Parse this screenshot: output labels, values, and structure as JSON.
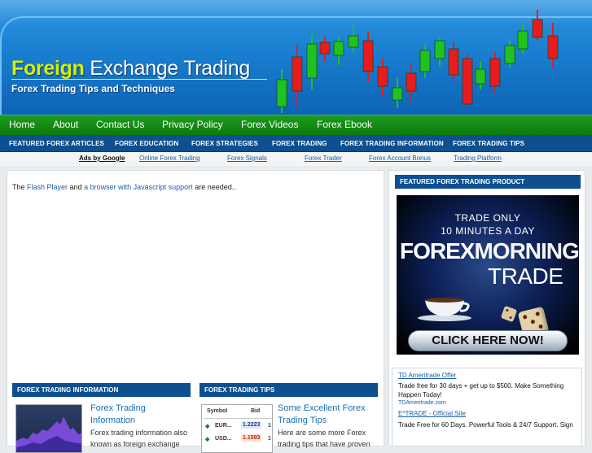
{
  "header": {
    "title_part1": "Foreign",
    "title_part2": "Exchange Trading",
    "tagline": "Forex Trading Tips and Techniques"
  },
  "nav": {
    "items": [
      "Home",
      "About",
      "Contact Us",
      "Privacy Policy",
      "Forex Videos",
      "Forex Ebook"
    ]
  },
  "categories": {
    "items": [
      "FEATURED FOREX ARTICLES",
      "FOREX EDUCATION",
      "FOREX STRATEGIES",
      "FOREX TRADING",
      "FOREX TRADING INFORMATION",
      "FOREX TRADING TIPS"
    ]
  },
  "ads_bar": {
    "label": "Ads by Google",
    "links": [
      "Online Forex Trading",
      "Forex Signals",
      "Forex Trader",
      "Forex Account Bonus",
      "Trading Platform"
    ]
  },
  "main": {
    "flash": {
      "pre": "The",
      "link1": "Flash Player",
      "mid": "and",
      "link2": "a browser with Javascript support",
      "post": "are needed.."
    },
    "sections": [
      {
        "heading": "FOREX TRADING INFORMATION",
        "title": "Forex Trading Information",
        "excerpt": "Forex trading information also known as foreign exchange"
      },
      {
        "heading": "FOREX TRADING TIPS",
        "title": "Some Excellent Forex Trading Tips",
        "excerpt": "Here are some more Forex trading tips that have proven"
      }
    ],
    "thumb_table": {
      "col_symbol": "Symbol",
      "col_bid": "Bid",
      "rows": [
        {
          "symbol": "EUR...",
          "bid": "1.2223",
          "extra": "1"
        },
        {
          "symbol": "USD...",
          "bid": "1.1593",
          "extra": "1"
        }
      ]
    }
  },
  "sidebar": {
    "heading": "FEATURED FOREX TRADING PRODUCT",
    "banner": {
      "line1": "TRADE ONLY",
      "line2": "10 MINUTES A DAY",
      "brand1": "FOREX",
      "brand2": "MORNING",
      "brand3": "TRADE",
      "cta": "CLICK HERE NOW!"
    },
    "ads": [
      {
        "title": "TD Ameritrade Offer",
        "desc": "Trade free for 30 days + get up to $500. Make Something Happen Today!",
        "url": "TDAmeritrade.com"
      },
      {
        "title": "E*TRADE - Official Site",
        "desc": "Trade Free for 60 Days. Powerful Tools & 24/7 Support. Sign",
        "url": ""
      }
    ]
  },
  "colors": {
    "header_blue": "#1a7fd0",
    "nav_green": "#118a11",
    "category_navy": "#0d4f8f",
    "title_accent": "#d5ef00",
    "candle_red": "#e81c1c",
    "candle_green": "#1fc21f"
  }
}
